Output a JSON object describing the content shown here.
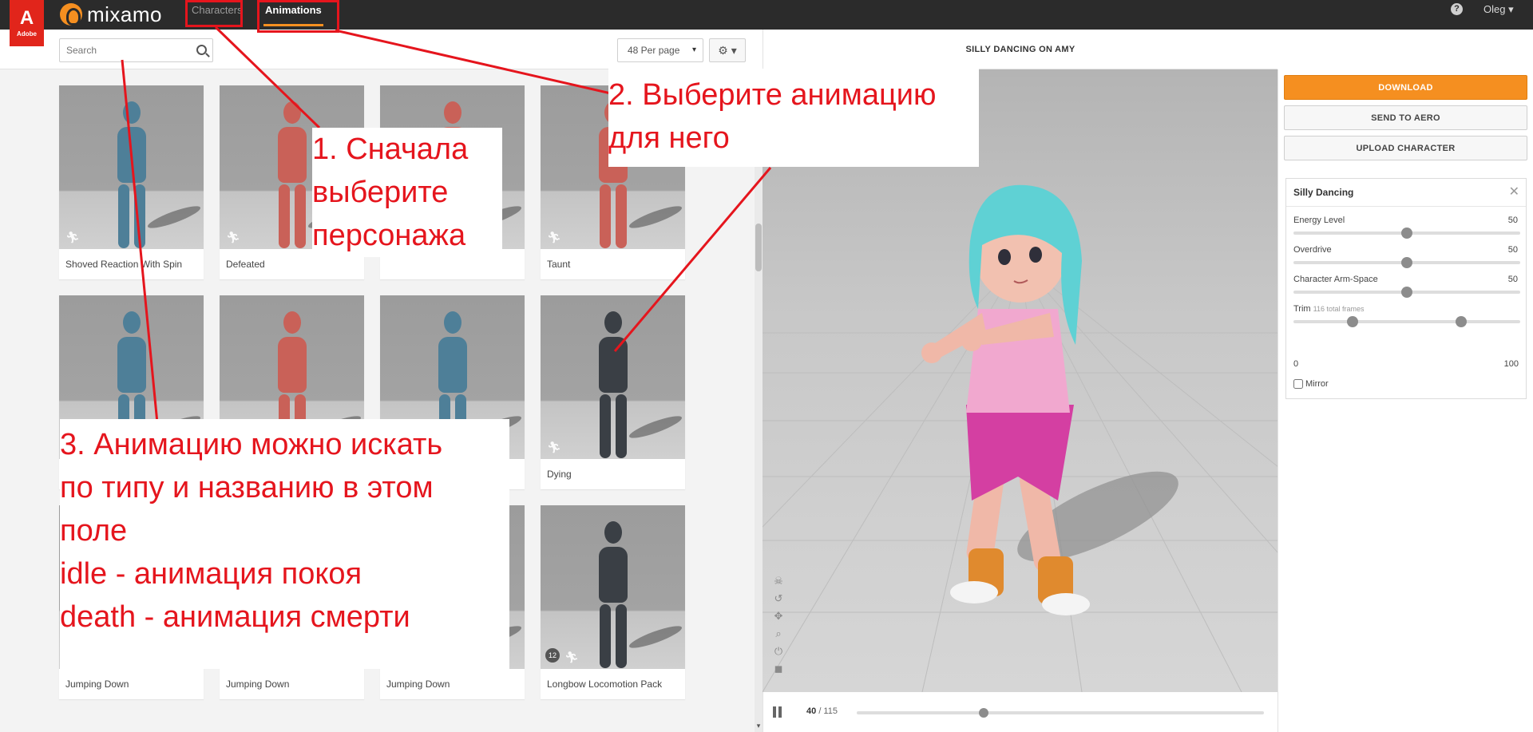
{
  "topbar": {
    "logo_mark": "A",
    "logo_text": "Adobe",
    "brand_name": "mixamo",
    "nav_characters": "Characters",
    "nav_animations": "Animations",
    "help_symbol": "?",
    "user_name": "Oleg",
    "icons": {
      "brand": "mixamo-logo-icon",
      "help": "help-icon",
      "user_caret": "chevron-down-icon"
    }
  },
  "toolbar": {
    "search_placeholder": "Search",
    "per_page": "48 Per page",
    "settings_symbol": "⚙ ▾"
  },
  "cards": [
    {
      "label": "Shoved Reaction With Spin",
      "tone": "blue"
    },
    {
      "label": "Defeated",
      "tone": "red"
    },
    {
      "label": "",
      "tone": "red"
    },
    {
      "label": "Taunt",
      "tone": "red"
    },
    {
      "label": "",
      "tone": "blue"
    },
    {
      "label": "",
      "tone": "red"
    },
    {
      "label": "",
      "tone": "blue"
    },
    {
      "label": "Dying",
      "tone": "dark"
    },
    {
      "label": "Jumping Down",
      "tone": "blue"
    },
    {
      "label": "Jumping Down",
      "tone": "red"
    },
    {
      "label": "Jumping Down",
      "tone": "blue"
    },
    {
      "label": "Longbow Locomotion Pack",
      "tone": "dark",
      "pack_count": "12"
    }
  ],
  "viewer": {
    "title": "SILLY DANCING ON AMY",
    "current_frame": "40",
    "total_frames_label": "/ 115",
    "timeline_position": 0.3,
    "tool_icons": [
      "skull-icon",
      "undo-icon",
      "move-icon",
      "zoom-icon",
      "power-icon",
      "camera-icon"
    ]
  },
  "panel": {
    "download_label": "DOWNLOAD",
    "send_label": "SEND TO AERO",
    "upload_label": "UPLOAD CHARACTER",
    "animation_name": "Silly Dancing",
    "params": [
      {
        "name": "Energy Level",
        "value": "50",
        "level": 0.5
      },
      {
        "name": "Overdrive",
        "value": "50",
        "level": 0.5
      },
      {
        "name": "Character Arm-Space",
        "value": "50",
        "level": 0.5
      }
    ],
    "trim": {
      "name": "Trim",
      "sub": "116 total frames",
      "min": "0",
      "max": "100",
      "start": 0.26,
      "end": 0.74
    },
    "mirror_label": "Mirror"
  },
  "annotations": {
    "step1": [
      "1. Сначала",
      "выберите",
      "персонажа"
    ],
    "step2": [
      "2. Выберите анимацию",
      "для него"
    ],
    "step3": [
      "3. Анимацию можно искать",
      "по типу и названию в этом",
      "поле",
      "idle - анимация покоя",
      "death  - анимация смерти"
    ]
  },
  "colors": {
    "accent": "#f58f20",
    "adobe_red": "#e1251b",
    "annotation_red": "#e5151d",
    "topbar": "#2b2b2b"
  }
}
